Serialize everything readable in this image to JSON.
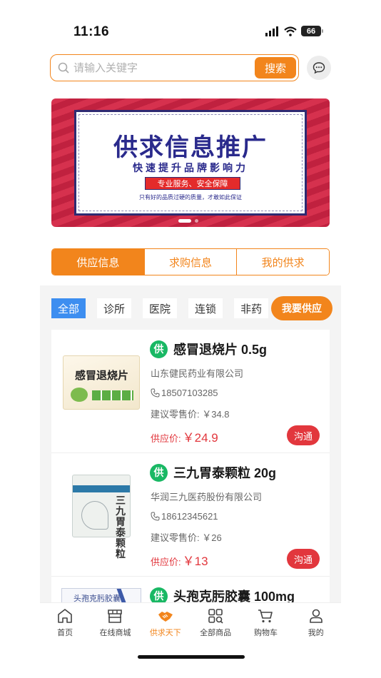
{
  "status_bar": {
    "time": "11:16",
    "battery": "66"
  },
  "search": {
    "placeholder": "请输入关键字",
    "button_label": "搜索"
  },
  "banner": {
    "title": "供求信息推广",
    "subtitle": "快速提升品牌影响力",
    "pill": "专业服务、安全保障",
    "note": "只有好的品质过硬的质量，才敢如此保证"
  },
  "tabs": [
    {
      "label": "供应信息",
      "active": true
    },
    {
      "label": "求购信息",
      "active": false
    },
    {
      "label": "我的供求",
      "active": false
    }
  ],
  "filters": {
    "chips": [
      "全部",
      "诊所",
      "医院",
      "连锁",
      "非药"
    ],
    "active_index": 0,
    "supply_button": "我要供应"
  },
  "products": [
    {
      "tag": "供",
      "name": "感冒退烧片 0.5g",
      "company": "山东健民药业有限公司",
      "phone": "18507103285",
      "retail": "建议零售价: ￥34.8",
      "supply_label": "供应价:",
      "supply_price": "￥24.9",
      "contact": "沟通",
      "image_text": "感冒退烧片"
    },
    {
      "tag": "供",
      "name": "三九胃泰颗粒 20g",
      "company": "华润三九医药股份有限公司",
      "phone": "18612345621",
      "retail": "建议零售价: ￥26",
      "supply_label": "供应价:",
      "supply_price": "￥13",
      "contact": "沟通",
      "image_text": "三九胃泰颗粒"
    },
    {
      "tag": "供",
      "name": "头孢克肟胶囊 100mg",
      "image_text": "头孢克肟胶囊"
    }
  ],
  "bottom_nav": [
    {
      "label": "首页",
      "icon": "home-icon",
      "active": false
    },
    {
      "label": "在线商城",
      "icon": "store-icon",
      "active": false
    },
    {
      "label": "供求天下",
      "icon": "handshake-icon",
      "active": true
    },
    {
      "label": "全部商品",
      "icon": "grid-icon",
      "active": false
    },
    {
      "label": "购物车",
      "icon": "cart-icon",
      "active": false
    },
    {
      "label": "我的",
      "icon": "user-icon",
      "active": false
    }
  ],
  "colors": {
    "accent": "#f2851c",
    "price_red": "#e2373d",
    "tag_green": "#19b864",
    "chip_blue": "#3d8ef0"
  }
}
